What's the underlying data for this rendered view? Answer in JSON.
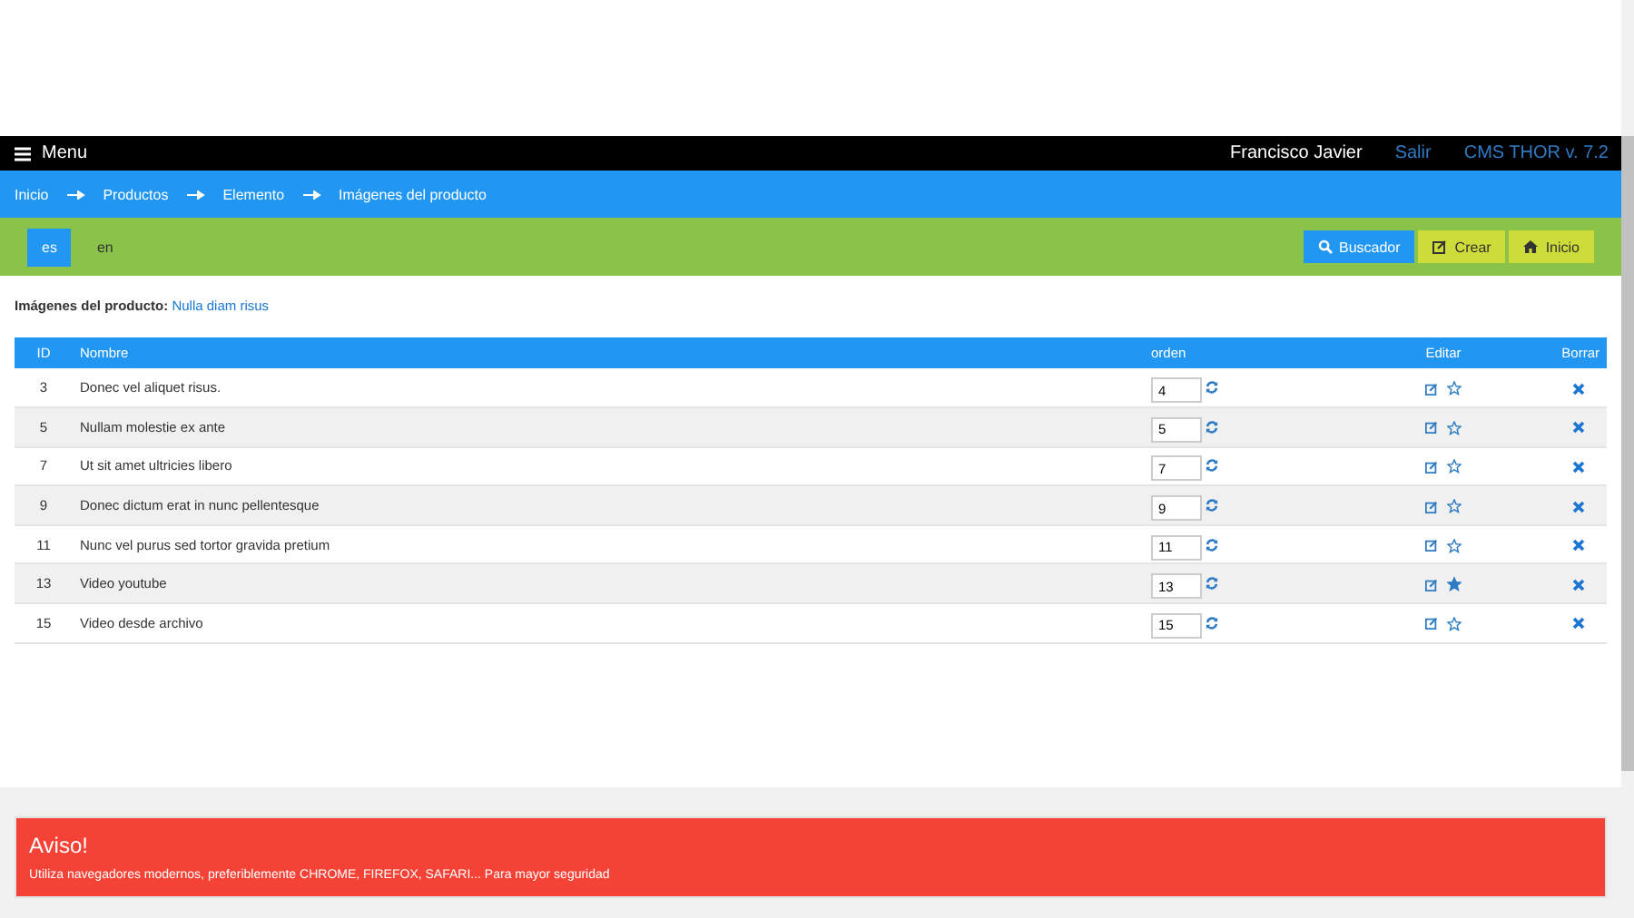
{
  "navbar": {
    "menu_label": "Menu",
    "user": "Francisco Javier",
    "logout": "Salir",
    "version": "CMS THOR v. 7.2"
  },
  "breadcrumb": [
    "Inicio",
    "Productos",
    "Elemento",
    "Imágenes del producto"
  ],
  "languages": [
    {
      "label": "es",
      "selected": true
    },
    {
      "label": "en",
      "selected": false
    }
  ],
  "actions": [
    {
      "kind": "search",
      "label": "Buscador"
    },
    {
      "kind": "create",
      "label": "Crear"
    },
    {
      "kind": "home",
      "label": "Inicio"
    }
  ],
  "heading": {
    "label": "Imágenes del producto:",
    "product": "Nulla diam risus"
  },
  "table": {
    "columns": [
      "ID",
      "Nombre",
      "orden",
      "Editar",
      "Borrar"
    ],
    "rows": [
      {
        "id": "3",
        "name": "Donec vel aliquet risus.",
        "order": "4",
        "featured": false
      },
      {
        "id": "5",
        "name": "Nullam molestie ex ante",
        "order": "5",
        "featured": false
      },
      {
        "id": "7",
        "name": "Ut sit amet ultricies libero",
        "order": "7",
        "featured": false
      },
      {
        "id": "9",
        "name": "Donec dictum erat in nunc pellentesque",
        "order": "9",
        "featured": false
      },
      {
        "id": "11",
        "name": "Nunc vel purus sed tortor gravida pretium",
        "order": "11",
        "featured": false
      },
      {
        "id": "13",
        "name": "Video youtube",
        "order": "13",
        "featured": true
      },
      {
        "id": "15",
        "name": "Video desde archivo",
        "order": "15",
        "featured": false
      }
    ]
  },
  "alert": {
    "title": "Aviso!",
    "message": "Utiliza navegadores modernos, preferiblemente CHROME, FIREFOX, SAFARI... Para mayor seguridad"
  }
}
